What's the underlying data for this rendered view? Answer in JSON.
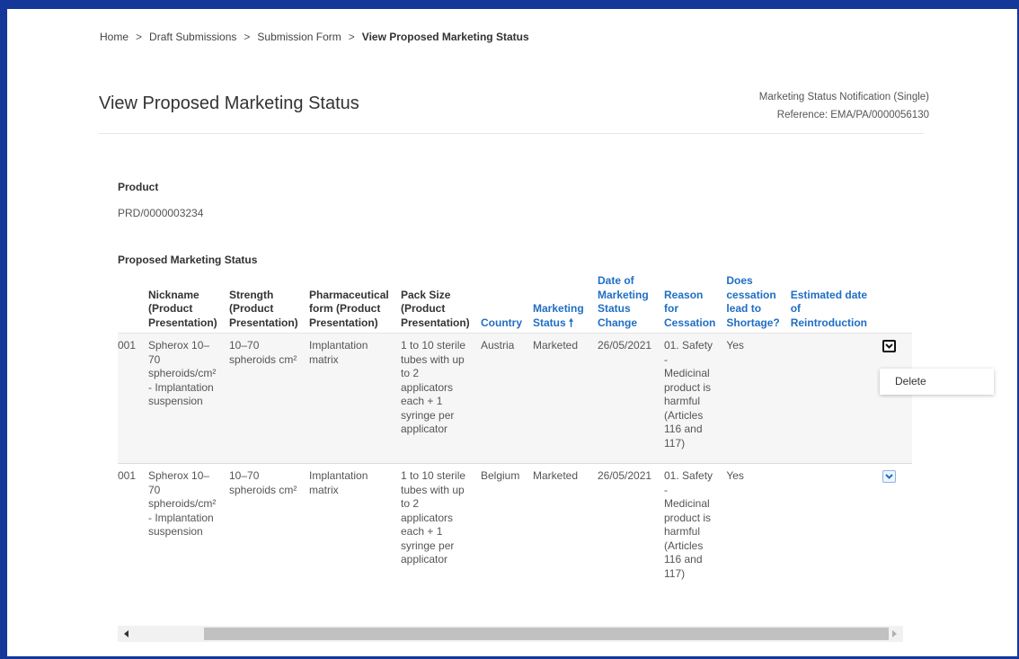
{
  "breadcrumb": {
    "items": [
      "Home",
      "Draft Submissions",
      "Submission Form"
    ],
    "separator": ">",
    "current": "View Proposed Marketing Status"
  },
  "page": {
    "title": "View Proposed Marketing Status",
    "notification_type": "Marketing Status Notification (Single)",
    "reference": "Reference: EMA/PA/0000056130"
  },
  "product": {
    "label": "Product",
    "value": "PRD/0000003234"
  },
  "table": {
    "section_label": "Proposed Marketing Status",
    "sort_arrow": "🠕",
    "headers": [
      "",
      "Nickname (Product Presentation)",
      "Strength (Product Presentation)",
      "Pharmaceutical form (Product Presentation)",
      "Pack Size (Product Presentation)",
      "Country",
      "Marketing Status",
      "Date of Marketing Status Change",
      "Reason for Cessation",
      "Does cessation lead to Shortage?",
      "Estimated date of Reintroduction",
      ""
    ],
    "rows": [
      {
        "id": "001",
        "nickname": "Spherox 10–70 spheroids/cm² - Implantation suspension",
        "strength": "10–70 spheroids cm²",
        "form": "Implantation matrix",
        "pack_size": "1 to 10 sterile tubes with up to 2 applicators each + 1 syringe per applicator",
        "country": "Austria",
        "status": "Marketed",
        "date": "26/05/2021",
        "reason": "01. Safety - Medicinal product is harmful (Articles 116 and 117)",
        "shortage": "Yes",
        "reintroduction": ""
      },
      {
        "id": "001",
        "nickname": "Spherox 10–70 spheroids/cm² - Implantation suspension",
        "strength": "10–70 spheroids cm²",
        "form": "Implantation matrix",
        "pack_size": "1 to 10 sterile tubes with up to 2 applicators each + 1 syringe per applicator",
        "country": "Belgium",
        "status": "Marketed",
        "date": "26/05/2021",
        "reason": "01. Safety - Medicinal product is harmful (Articles 116 and 117)",
        "shortage": "Yes",
        "reintroduction": ""
      }
    ]
  },
  "row_menu": {
    "items": [
      "Delete"
    ]
  },
  "icons": {
    "actions": "chevron-down-icon",
    "scroll_left": "arrow-left-icon",
    "scroll_right": "arrow-right-icon",
    "sort": "sort-ascending-icon"
  },
  "colors": {
    "frame": "#14379a",
    "link": "#1f6ec4",
    "row_highlight": "#f6f6f6"
  }
}
